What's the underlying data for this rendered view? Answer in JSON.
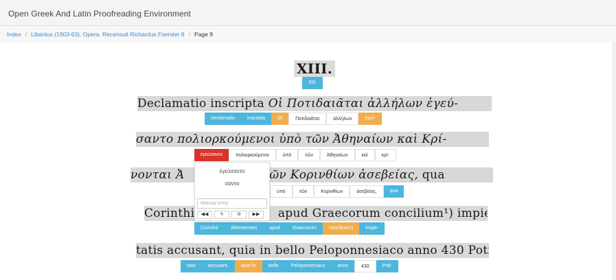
{
  "app": {
    "title": "Open Greek And Latin Proofreading Environment"
  },
  "breadcrumb": {
    "index": "Index",
    "volume": "Libanius (1903-63). Opera. Recensuit Richardus Foerster 6",
    "page": "Page 9"
  },
  "lines": [
    {
      "scan": "XIII.",
      "tokens": [
        {
          "text": "XIII.",
          "style": "blue"
        }
      ]
    },
    {
      "scan_latin": "Declamatio inscripta ",
      "scan_greek": "Οἱ Ποτιδαιᾶται ἀλλήλων ἐγεύ-",
      "tokens": [
        {
          "text": "Declamatio",
          "style": "blue"
        },
        {
          "text": "inscripta",
          "style": "blue"
        },
        {
          "text": "Oi",
          "style": "orange"
        },
        {
          "text": "Ποτιδαιᾶται",
          "style": "white"
        },
        {
          "text": "ἀλλήλων",
          "style": "white"
        },
        {
          "text": "ἐγεύ-",
          "style": "orange"
        }
      ]
    },
    {
      "scan_greek": "σαντο πολιορκούμενοι ὑπὸ τῶν Ἀθηναίων καὶ Κρί-",
      "tokens": [
        {
          "text": "ἐγεύσαντο",
          "style": "red"
        },
        {
          "text": "πολιορκούμενοι",
          "style": "white"
        },
        {
          "text": "ὑπὸ",
          "style": "white"
        },
        {
          "text": "τῶν",
          "style": "white"
        },
        {
          "text": "Ἀθηναίων",
          "style": "white"
        },
        {
          "text": "καὶ",
          "style": "white"
        },
        {
          "text": "κρί-",
          "style": "white"
        }
      ]
    },
    {
      "scan_greek": "νονται Ἀ",
      "scan_greek_tail": "ὸ τῶν Κορινθίων ἀσεβείας,",
      "scan_latin_tail": " qua",
      "tokens": [
        {
          "text": "ὑπὸ",
          "style": "white"
        },
        {
          "text": "τῶν",
          "style": "white"
        },
        {
          "text": "Κορινθίων",
          "style": "white"
        },
        {
          "text": "ἀσεβείας,",
          "style": "white"
        },
        {
          "text": "qua",
          "style": "blue"
        }
      ]
    },
    {
      "scan_latin": "Corinthii",
      "scan_latin_tail": "apud Graecorum concilium¹) impie-",
      "tokens": [
        {
          "text": "Corinthii",
          "style": "blue"
        },
        {
          "text": "Athenienses",
          "style": "blue"
        },
        {
          "text": "apud",
          "style": "blue"
        },
        {
          "text": "Graecorum",
          "style": "blue"
        },
        {
          "text": "concilium1)",
          "style": "orange"
        },
        {
          "text": "impie-",
          "style": "blue"
        }
      ]
    },
    {
      "scan_latin": "tatis accusant, quia in bello Peloponnesiaco anno 430 Poti-",
      "tokens": [
        {
          "text": "tatis",
          "style": "blue"
        },
        {
          "text": "accusant,",
          "style": "blue"
        },
        {
          "text": "quia^in",
          "style": "orange"
        },
        {
          "text": "bello",
          "style": "blue"
        },
        {
          "text": "Peloponnesiaco",
          "style": "blue"
        },
        {
          "text": "anno",
          "style": "blue"
        },
        {
          "text": "430",
          "style": "white"
        },
        {
          "text": "Poti-",
          "style": "blue"
        }
      ]
    }
  ],
  "popup": {
    "suggestions": [
      "ἐγεύσαντο",
      "σαντο"
    ],
    "manual_placeholder": "Manual entry",
    "buttons": [
      {
        "glyph": "◀◀",
        "icon": "first-icon"
      },
      {
        "glyph": "ϟ",
        "icon": "bolt-icon"
      },
      {
        "glyph": "⊘",
        "icon": "ban-icon"
      },
      {
        "glyph": "▶▶",
        "icon": "last-icon"
      }
    ]
  },
  "colors": {
    "blue": "#4db6dc",
    "orange": "#f0ad4e",
    "red": "#d9342b"
  }
}
